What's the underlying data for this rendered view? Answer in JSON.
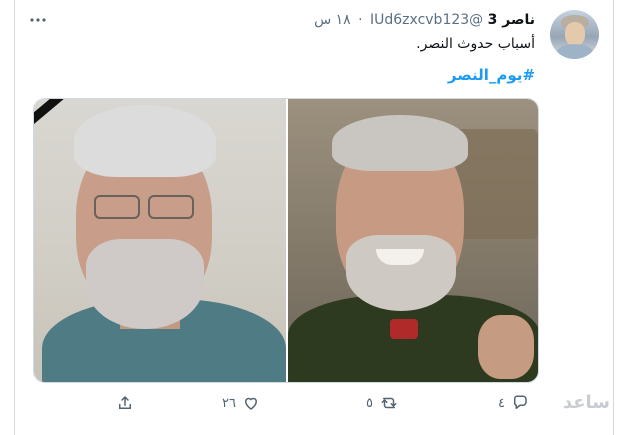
{
  "tweet": {
    "display_name": "ناصر 3",
    "handle": "@IUd6zxcvb123",
    "separator": "·",
    "time": "١٨ س",
    "text": "أسباب حدوث النصر.",
    "hashtag": "#يوم_النصر"
  },
  "actions": {
    "reply_count": "٤",
    "retweet_count": "٥",
    "like_count": "٢٦"
  },
  "icons": {
    "more": "more-horizontal-icon",
    "reply": "reply-icon",
    "retweet": "retweet-icon",
    "like": "heart-icon",
    "share": "share-icon"
  },
  "colors": {
    "hashtag": "#1d9bf0",
    "muted": "#536471",
    "text": "#0f1419"
  }
}
